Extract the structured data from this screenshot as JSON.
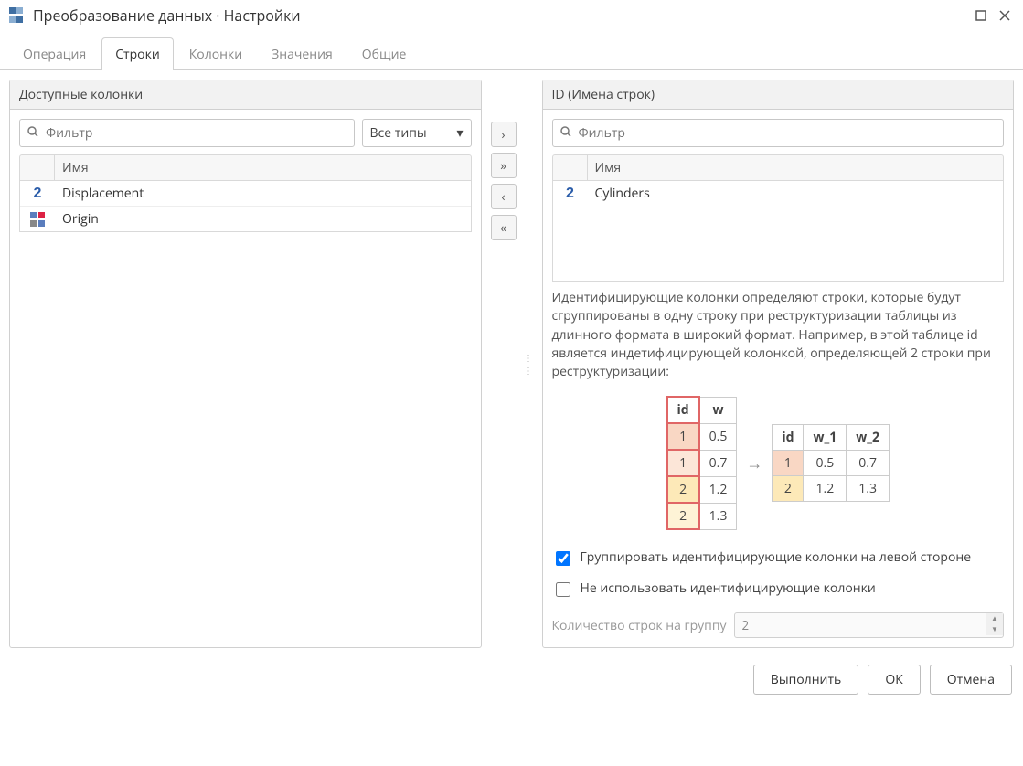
{
  "title": "Преобразование данных · Настройки",
  "tabs": [
    "Операция",
    "Строки",
    "Колонки",
    "Значения",
    "Общие"
  ],
  "active_tab": 1,
  "left": {
    "header": "Доступные колонки",
    "filter_placeholder": "Фильтр",
    "type_dropdown": "Все типы",
    "col_header": "Имя",
    "rows": [
      {
        "icon": "number",
        "name": "Displacement"
      },
      {
        "icon": "category",
        "name": "Origin"
      }
    ]
  },
  "right": {
    "header": "ID (Имена строк)",
    "filter_placeholder": "Фильтр",
    "col_header": "Имя",
    "rows": [
      {
        "icon": "number",
        "name": "Cylinders"
      }
    ],
    "description": "Идентифицирующие колонки определяют строки, которые будут сгруппированы в одну строку при реструктуризации таблицы из длинного формата в широкий формат. Например, в этой таблице id является индетифицирующей колонкой, определяющей 2 строки при реструктуризации:",
    "example_left": {
      "headers": [
        "id",
        "w"
      ],
      "rows": [
        [
          "1",
          "0.5"
        ],
        [
          "1",
          "0.7"
        ],
        [
          "2",
          "1.2"
        ],
        [
          "2",
          "1.3"
        ]
      ]
    },
    "example_right": {
      "headers": [
        "id",
        "w_1",
        "w_2"
      ],
      "rows": [
        [
          "1",
          "0.5",
          "0.7"
        ],
        [
          "2",
          "1.2",
          "1.3"
        ]
      ]
    },
    "opt_group": "Группировать идентифицирующие колонки на левой стороне",
    "opt_noid": "Не использовать идентифицирующие колонки",
    "rows_per_group_label": "Количество строк на группу",
    "rows_per_group_value": "2"
  },
  "buttons": {
    "run": "Выполнить",
    "ok": "ОК",
    "cancel": "Отмена"
  },
  "movers": [
    "›",
    "»",
    "‹",
    "«"
  ]
}
